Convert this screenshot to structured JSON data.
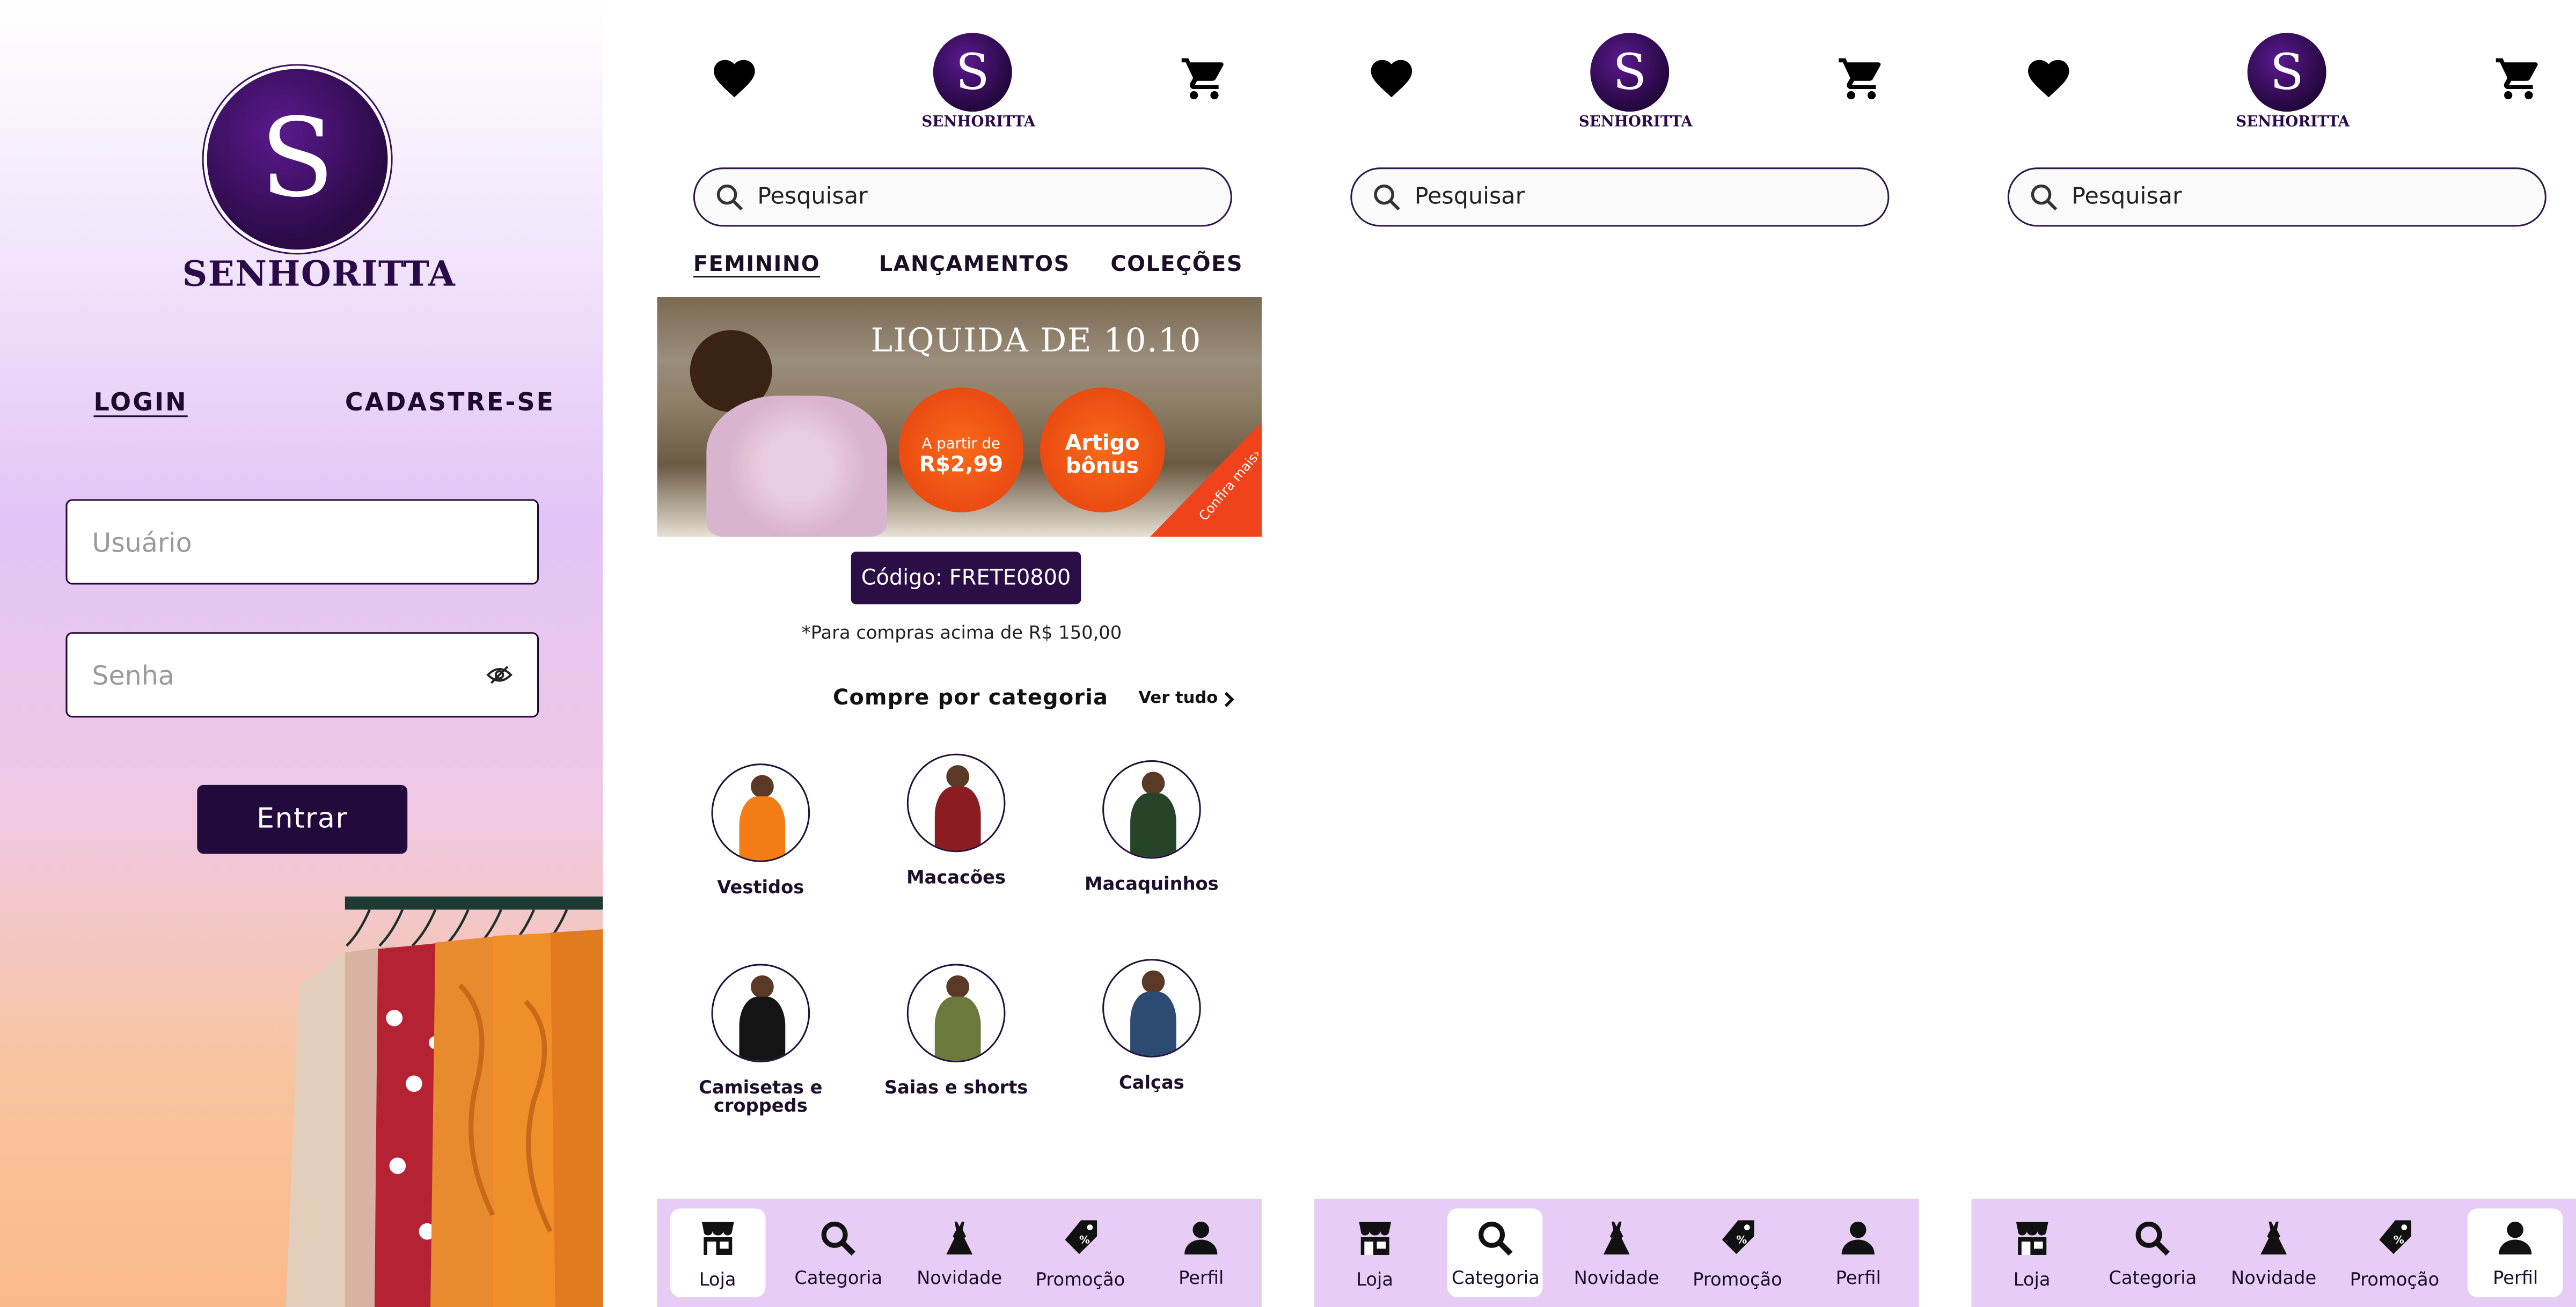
{
  "brand": {
    "letter": "S",
    "name": "SENHORITTA"
  },
  "login": {
    "tabs": {
      "login": "LOGIN",
      "signup": "CADASTRE-SE"
    },
    "username_placeholder": "Usuário",
    "password_placeholder": "Senha",
    "submit": "Entrar"
  },
  "search": {
    "placeholder": "Pesquisar"
  },
  "home": {
    "tabs": [
      "FEMININO",
      "LANÇAMENTOS",
      "COLEÇÕES"
    ],
    "banner": {
      "title": "LIQUIDA DE 10.10",
      "badge1_top": "A partir de",
      "badge1_price": "R$2,99",
      "badge2_line1": "Artigo",
      "badge2_line2": "bônus",
      "corner": "Confira mais›"
    },
    "coupon": "Código: FRETE0800",
    "coupon_note": "*Para compras acima de R$ 150,00",
    "section_title": "Compre por categoria",
    "see_all": "Ver tudo",
    "categories": [
      {
        "label": "Vestidos",
        "color": "#f47c14"
      },
      {
        "label": "Macacões",
        "color": "#8a1c22"
      },
      {
        "label": "Macaquinhos",
        "color": "#264427"
      },
      {
        "label": "Camisetas e croppeds",
        "color": "#141414"
      },
      {
        "label": "Saias e shorts",
        "color": "#6b7a3c"
      },
      {
        "label": "Calças",
        "color": "#2d4a73"
      }
    ]
  },
  "nav": {
    "items": [
      "Loja",
      "Categoria",
      "Novidade",
      "Promoção",
      "Perfil"
    ]
  },
  "colors": {
    "brand": "#2b0a48",
    "nav_bg": "#e7ccf5",
    "coupon_bg": "#2b0e45"
  }
}
